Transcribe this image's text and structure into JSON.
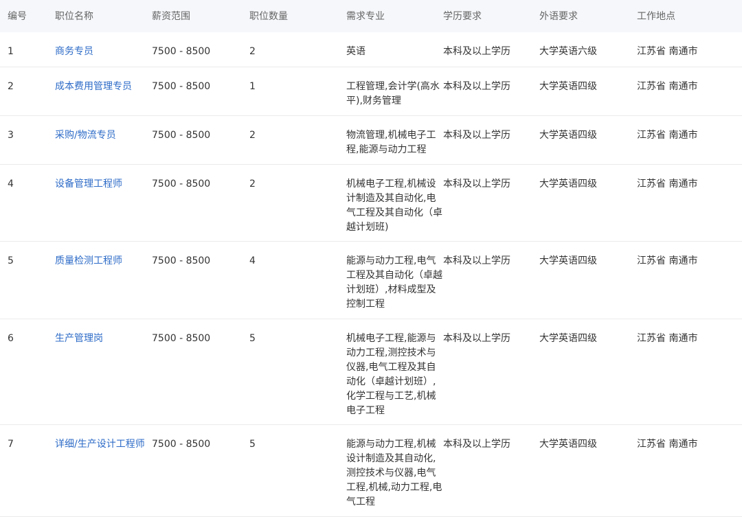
{
  "table": {
    "headers": [
      "编号",
      "职位名称",
      "薪资范围",
      "职位数量",
      "需求专业",
      "学历要求",
      "外语要求",
      "工作地点"
    ],
    "rows": [
      {
        "id": "1",
        "title": "商务专员",
        "salary": "7500 - 8500",
        "count": "2",
        "major": "英语",
        "education": "本科及以上学历",
        "language": "大学英语六级",
        "location": "江苏省 南通市"
      },
      {
        "id": "2",
        "title": "成本费用管理专员",
        "salary": "7500 - 8500",
        "count": "1",
        "major": "工程管理,会计学(高水平),财务管理",
        "education": "本科及以上学历",
        "language": "大学英语四级",
        "location": "江苏省 南通市"
      },
      {
        "id": "3",
        "title": "采购/物流专员",
        "salary": "7500 - 8500",
        "count": "2",
        "major": "物流管理,机械电子工程,能源与动力工程",
        "education": "本科及以上学历",
        "language": "大学英语四级",
        "location": "江苏省 南通市"
      },
      {
        "id": "4",
        "title": "设备管理工程师",
        "salary": "7500 - 8500",
        "count": "2",
        "major": "机械电子工程,机械设计制造及其自动化,电气工程及其自动化（卓越计划班)",
        "education": "本科及以上学历",
        "language": "大学英语四级",
        "location": "江苏省 南通市"
      },
      {
        "id": "5",
        "title": "质量检测工程师",
        "salary": "7500 - 8500",
        "count": "4",
        "major": "能源与动力工程,电气工程及其自动化（卓越计划班）,材料成型及控制工程",
        "education": "本科及以上学历",
        "language": "大学英语四级",
        "location": "江苏省 南通市"
      },
      {
        "id": "6",
        "title": "生产管理岗",
        "salary": "7500 - 8500",
        "count": "5",
        "major": "机械电子工程,能源与动力工程,测控技术与仪器,电气工程及其自动化（卓越计划班）,化学工程与工艺,机械电子工程",
        "education": "本科及以上学历",
        "language": "大学英语四级",
        "location": "江苏省 南通市"
      },
      {
        "id": "7",
        "title": "详细/生产设计工程师",
        "salary": "7500 - 8500",
        "count": "5",
        "major": "能源与动力工程,机械设计制造及其自动化,测控技术与仪器,电气工程,机械,动力工程,电气工程",
        "education": "本科及以上学历",
        "language": "大学英语四级",
        "location": "江苏省 南通市"
      }
    ]
  },
  "colors": {
    "header_bg": "#f5f7fa",
    "link": "#2d6bc7",
    "text": "#333333",
    "divider": "#ebebeb"
  }
}
